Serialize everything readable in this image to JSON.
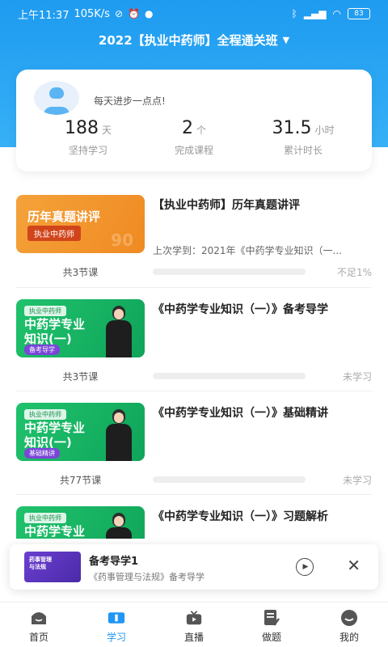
{
  "status_bar": {
    "time": "上午11:37",
    "speed": "105K/s",
    "battery": "83"
  },
  "header": {
    "class_title": "2022【执业中药师】全程通关班"
  },
  "stats": {
    "motto": "每天进步一点点!",
    "days": {
      "value": "188",
      "unit": "天",
      "label": "坚持学习"
    },
    "courses": {
      "value": "2",
      "unit": "个",
      "label": "完成课程"
    },
    "hours": {
      "value": "31.5",
      "unit": "小时",
      "label": "累计时长"
    }
  },
  "courses": [
    {
      "title": "【执业中药师】历年真题讲评",
      "thumb_title": "历年真题讲评",
      "thumb_tag": "执业中药师",
      "subtitle": "上次学到：2021年《中药学专业知识（一...",
      "lessons": "共3节课",
      "status": "不足1%",
      "progress": 0.01
    },
    {
      "title": "《中药学专业知识（一）》备考导学",
      "thumb_small": "执业中药师",
      "thumb_title": "中药学专业\n知识(一)",
      "thumb_pill": "备考导学",
      "lessons": "共3节课",
      "status": "未学习",
      "progress": 0
    },
    {
      "title": "《中药学专业知识（一）》基础精讲",
      "thumb_small": "执业中药师",
      "thumb_title": "中药学专业\n知识(一)",
      "thumb_pill": "基础精讲",
      "lessons": "共77节课",
      "status": "未学习",
      "progress": 0
    },
    {
      "title": "《中药学专业知识（一）》习题解析",
      "thumb_small": "执业中药师",
      "thumb_title": "中药学专业",
      "lessons": "",
      "status": ""
    }
  ],
  "mini_player": {
    "title": "备考导学1",
    "subtitle": "《药事管理与法规》备考导学",
    "thumb_text": "药事管理\n与法规"
  },
  "tabs": [
    {
      "label": "首页",
      "icon": "home-icon"
    },
    {
      "label": "学习",
      "icon": "book-icon",
      "active": true
    },
    {
      "label": "直播",
      "icon": "tv-icon"
    },
    {
      "label": "做题",
      "icon": "edit-icon"
    },
    {
      "label": "我的",
      "icon": "profile-icon"
    }
  ],
  "colors": {
    "primary": "#2196f3",
    "hero_top": "#1e9bf0",
    "orange_thumb": "#f08a22",
    "green_thumb": "#20c26c"
  }
}
